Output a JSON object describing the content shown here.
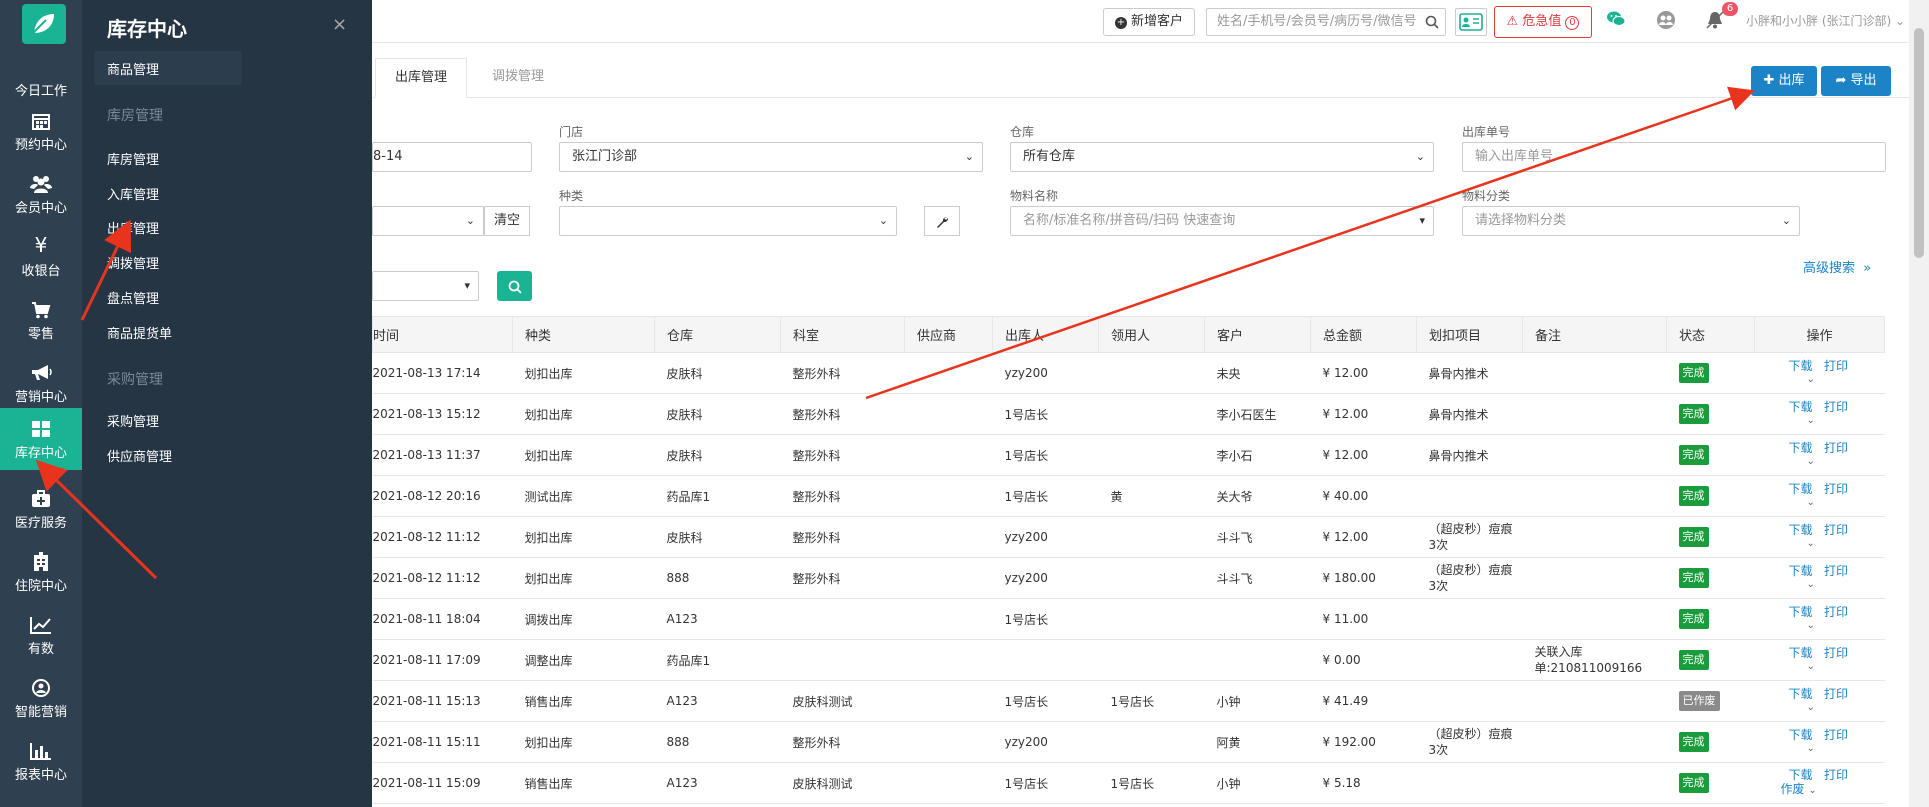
{
  "rail": {
    "items": [
      {
        "label": "今日工作",
        "icon": "home-icon"
      },
      {
        "label": "预约中心",
        "icon": "calendar-icon"
      },
      {
        "label": "会员中心",
        "icon": "users-icon"
      },
      {
        "label": "收银台",
        "icon": "yen-icon"
      },
      {
        "label": "零售",
        "icon": "cart-icon"
      },
      {
        "label": "营销中心",
        "icon": "megaphone-icon"
      },
      {
        "label": "库存中心",
        "icon": "grid-icon"
      },
      {
        "label": "医疗服务",
        "icon": "medkit-icon"
      },
      {
        "label": "住院中心",
        "icon": "hospital-icon"
      },
      {
        "label": "有数",
        "icon": "line-chart-icon"
      },
      {
        "label": "智能营销",
        "icon": "smart-icon"
      },
      {
        "label": "报表中心",
        "icon": "bar-chart-icon"
      }
    ]
  },
  "submenu": {
    "title": "库存中心",
    "close": "×",
    "items": {
      "goods": "商品管理",
      "group_warehouse": "库房管理",
      "warehouse": "库房管理",
      "inbound": "入库管理",
      "outbound": "出库管理",
      "transfer": "调拨管理",
      "stocktake": "盘点管理",
      "pickup": "商品提货单",
      "group_purchase": "采购管理",
      "purchase": "采购管理",
      "supplier": "供应商管理"
    }
  },
  "header": {
    "new_customer": "新增客户",
    "search_placeholder": "姓名/手机号/会员号/病历号/微信号",
    "danger": "危急值",
    "danger_count": "0",
    "notice_count": "6",
    "user": "小胖和小小胖 (张江门诊部)"
  },
  "tabs": {
    "outbound": "出库管理",
    "transfer": "调拨管理"
  },
  "actions": {
    "out": "出库",
    "export": "导出"
  },
  "filters": {
    "date_value": "8-14",
    "store_label": "门店",
    "store_value": "张江门诊部",
    "warehouse_label": "仓库",
    "warehouse_value": "所有仓库",
    "order_no_label": "出库单号",
    "order_no_placeholder": "输入出库单号",
    "clear": "清空",
    "type_label": "种类",
    "material_name_label": "物料名称",
    "material_name_placeholder": "名称/标准名称/拼音码/扫码 快速查询",
    "material_cat_label": "物料分类",
    "material_cat_placeholder": "请选择物料分类",
    "advanced": "高级搜索"
  },
  "table": {
    "columns": [
      "时间",
      "种类",
      "仓库",
      "科室",
      "供应商",
      "出库人",
      "领用人",
      "客户",
      "总金额",
      "划扣项目",
      "备注",
      "状态",
      "操作"
    ],
    "op_download": "下载",
    "op_print": "打印",
    "op_void": "作废",
    "rows": [
      {
        "time": "2021-08-13 17:14",
        "type": "划扣出库",
        "warehouse": "皮肤科",
        "dept": "整形外科",
        "supplier": "",
        "out_by": "yzy200",
        "receiver": "",
        "customer": "未央",
        "amount": "¥ 12.00",
        "project": "鼻骨内推术",
        "remark": "",
        "status": "完成"
      },
      {
        "time": "2021-08-13 15:12",
        "type": "划扣出库",
        "warehouse": "皮肤科",
        "dept": "整形外科",
        "supplier": "",
        "out_by": "1号店长",
        "receiver": "",
        "customer": "李小石医生",
        "amount": "¥ 12.00",
        "project": "鼻骨内推术",
        "remark": "",
        "status": "完成"
      },
      {
        "time": "2021-08-13 11:37",
        "type": "划扣出库",
        "warehouse": "皮肤科",
        "dept": "整形外科",
        "supplier": "",
        "out_by": "1号店长",
        "receiver": "",
        "customer": "李小石",
        "amount": "¥ 12.00",
        "project": "鼻骨内推术",
        "remark": "",
        "status": "完成"
      },
      {
        "time": "2021-08-12 20:16",
        "type": "测试出库",
        "warehouse": "药品库1",
        "dept": "整形外科",
        "supplier": "",
        "out_by": "1号店长",
        "receiver": "黄",
        "customer": "关大爷",
        "amount": "¥ 40.00",
        "project": "",
        "remark": "",
        "status": "完成"
      },
      {
        "time": "2021-08-12 11:12",
        "type": "划扣出库",
        "warehouse": "皮肤科",
        "dept": "整形外科",
        "supplier": "",
        "out_by": "yzy200",
        "receiver": "",
        "customer": "斗斗飞",
        "amount": "¥ 12.00",
        "project": "（超皮秒）痘痕3次",
        "remark": "",
        "status": "完成"
      },
      {
        "time": "2021-08-12 11:12",
        "type": "划扣出库",
        "warehouse": "888",
        "dept": "整形外科",
        "supplier": "",
        "out_by": "yzy200",
        "receiver": "",
        "customer": "斗斗飞",
        "amount": "¥ 180.00",
        "project": "（超皮秒）痘痕3次",
        "remark": "",
        "status": "完成"
      },
      {
        "time": "2021-08-11 18:04",
        "type": "调拨出库",
        "warehouse": "A123",
        "dept": "",
        "supplier": "",
        "out_by": "1号店长",
        "receiver": "",
        "customer": "",
        "amount": "¥ 11.00",
        "project": "",
        "remark": "",
        "status": "完成"
      },
      {
        "time": "2021-08-11 17:09",
        "type": "调整出库",
        "warehouse": "药品库1",
        "dept": "",
        "supplier": "",
        "out_by": "",
        "receiver": "",
        "customer": "",
        "amount": "¥ 0.00",
        "project": "",
        "remark": "关联入库单:210811009166",
        "status": "完成"
      },
      {
        "time": "2021-08-11 15:13",
        "type": "销售出库",
        "warehouse": "A123",
        "dept": "皮肤科测试",
        "supplier": "",
        "out_by": "1号店长",
        "receiver": "1号店长",
        "customer": "小钟",
        "amount": "¥ 41.49",
        "project": "",
        "remark": "",
        "status": "已作废"
      },
      {
        "time": "2021-08-11 15:11",
        "type": "划扣出库",
        "warehouse": "888",
        "dept": "整形外科",
        "supplier": "",
        "out_by": "yzy200",
        "receiver": "",
        "customer": "阿黄",
        "amount": "¥ 192.00",
        "project": "（超皮秒）痘痕3次",
        "remark": "",
        "status": "完成"
      },
      {
        "time": "2021-08-11 15:09",
        "type": "销售出库",
        "warehouse": "A123",
        "dept": "皮肤科测试",
        "supplier": "",
        "out_by": "1号店长",
        "receiver": "1号店长",
        "customer": "小钟",
        "amount": "¥ 5.18",
        "project": "",
        "remark": "",
        "status": "完成"
      }
    ]
  },
  "colors": {
    "rail": "#2f4050",
    "submenu": "#253544",
    "accent": "#1ab394",
    "primary": "#1c84c6",
    "done": "#1a9b3c",
    "void": "#8a8a8a",
    "arrow": "#e8341c"
  }
}
